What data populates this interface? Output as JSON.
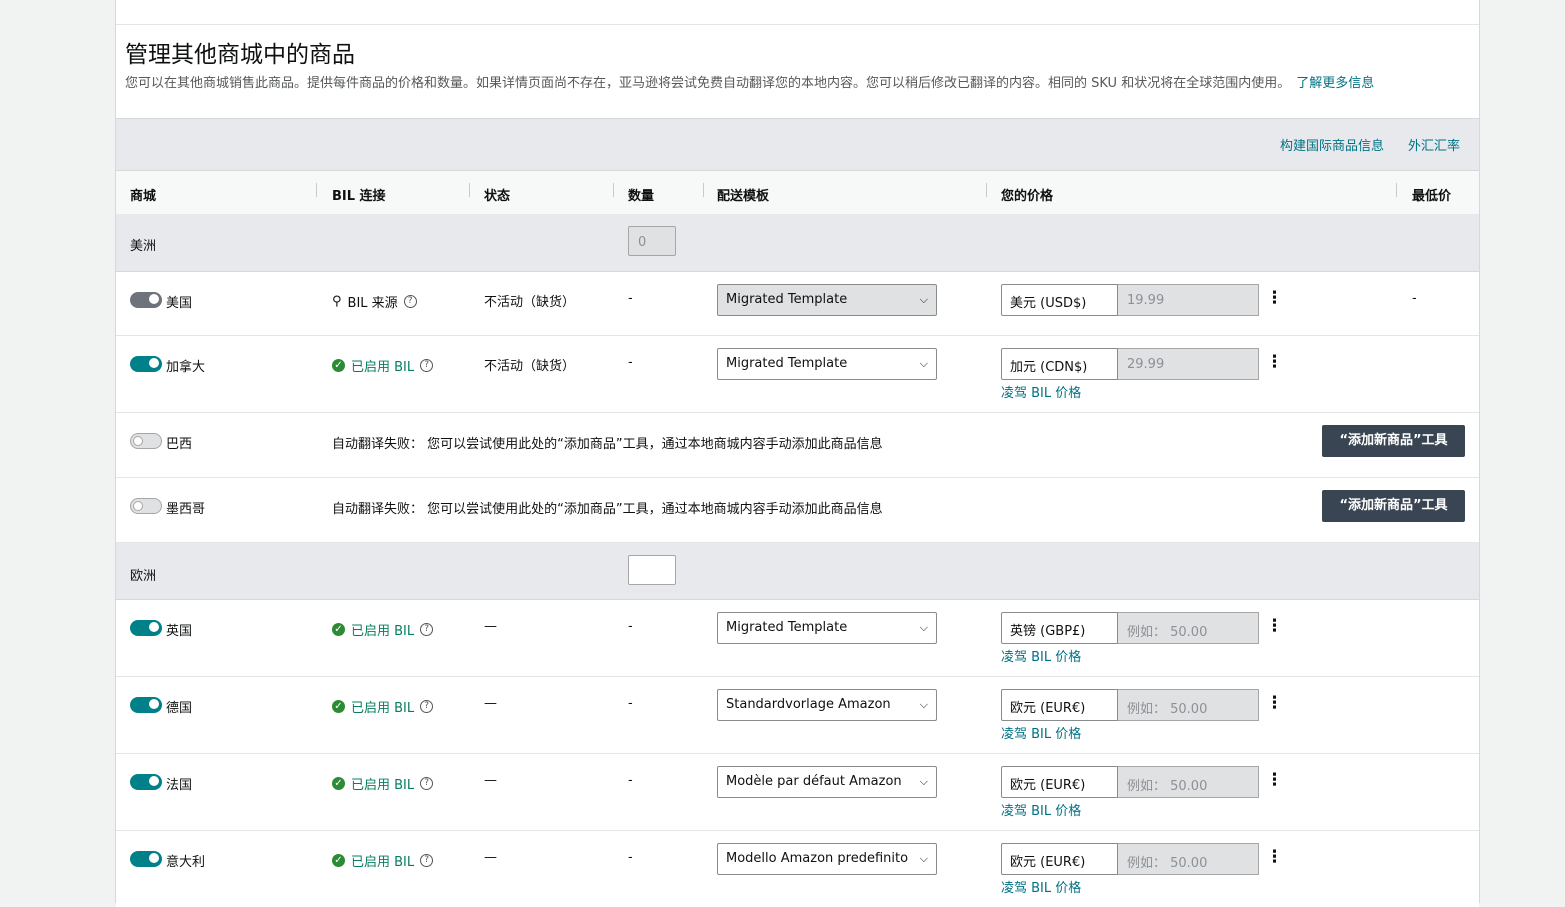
{
  "header": {
    "title": "管理其他商城中的商品",
    "description": "您可以在其他商城销售此商品。提供每件商品的价格和数量。如果详情页面尚不存在，亚马逊将尝试免费自动翻译您的本地内容。您可以稍后修改已翻译的内容。相同的 SKU 和状况将在全球范围内使用。",
    "learn_more": "了解更多信息"
  },
  "toolbar": {
    "build_intl": "构建国际商品信息",
    "fx_rate": "外汇汇率"
  },
  "columns": {
    "marketplace": "商城",
    "bil_link": "BIL 连接",
    "status": "状态",
    "quantity": "数量",
    "shipping_template": "配送模板",
    "your_price": "您的价格",
    "lowest_price": "最低价"
  },
  "regions": {
    "americas": {
      "label": "美洲",
      "quantity": "0"
    },
    "europe": {
      "label": "欧洲",
      "quantity": ""
    }
  },
  "icons": {
    "check": "check-circle-icon",
    "help": "question-circle-icon",
    "location": "location-pin-icon",
    "more": "more-vertical-icon",
    "dropdown": "chevron-down-icon"
  },
  "common": {
    "bil_enabled": "已启用 BIL",
    "bil_source": "BIL 来源",
    "dash": "-",
    "emdash": "—",
    "override_bil": "凌驾 BIL 价格",
    "price_placeholder": "例如： 50.00",
    "translate_fail": "自动翻译失败： 您可以尝试使用此处的“添加商品”工具，通过本地商城内容手动添加此商品信息",
    "add_tool": "“添加新商品”工具"
  },
  "rows": {
    "us": {
      "country": "美国",
      "status": "不活动（缺货）",
      "template": "Migrated Template",
      "currency": "美元 (USD$)",
      "price": "19.99",
      "lowest": "-"
    },
    "ca": {
      "country": "加拿大",
      "status": "不活动（缺货）",
      "template": "Migrated Template",
      "currency": "加元 (CDN$)",
      "price": "29.99"
    },
    "br": {
      "country": "巴西"
    },
    "mx": {
      "country": "墨西哥"
    },
    "uk": {
      "country": "英国",
      "template": "Migrated Template",
      "currency": "英镑 (GBP£)"
    },
    "de": {
      "country": "德国",
      "template": "Standardvorlage Amazon",
      "currency": "欧元 (EUR€)"
    },
    "fr": {
      "country": "法国",
      "template": "Modèle par défaut Amazon",
      "currency": "欧元 (EUR€)"
    },
    "it": {
      "country": "意大利",
      "template": "Modello Amazon predefinito",
      "currency": "欧元 (EUR€)"
    }
  },
  "colors": {
    "accent": "#00818a",
    "link": "#007185",
    "success": "#067d62",
    "button_dark": "#3a4553"
  }
}
